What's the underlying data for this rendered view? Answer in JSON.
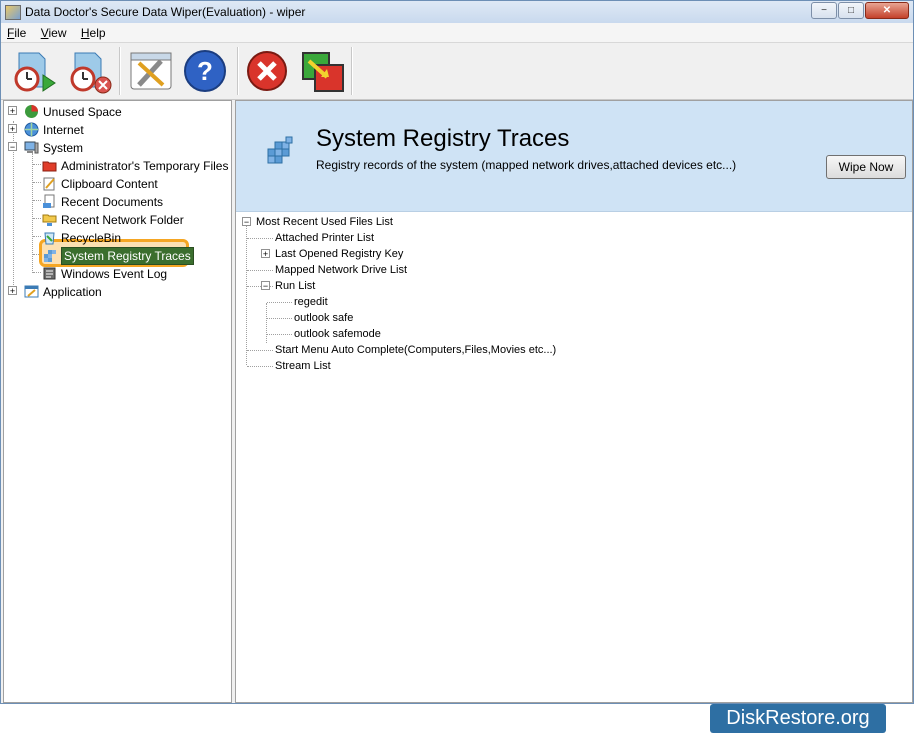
{
  "window": {
    "title": "Data Doctor's Secure Data Wiper(Evaluation) - wiper",
    "controls": {
      "minimize": "−",
      "maximize": "□",
      "close": "✕"
    }
  },
  "menu": {
    "file": "File",
    "view": "View",
    "help": "Help"
  },
  "toolbar": {
    "buttons": [
      {
        "icon": "schedule-wipe-icon"
      },
      {
        "icon": "stop-schedule-icon"
      },
      {
        "icon": "settings-tools-icon"
      },
      {
        "icon": "help-icon"
      },
      {
        "icon": "cancel-icon"
      },
      {
        "icon": "exit-icon"
      }
    ]
  },
  "left_tree": {
    "unused_space": "Unused Space",
    "internet": "Internet",
    "system": "System",
    "system_children": {
      "admin_temp": "Administrator's Temporary Files",
      "clipboard": "Clipboard Content",
      "recent_docs": "Recent Documents",
      "recent_network": "Recent Network Folder",
      "recycle_bin": "RecycleBin",
      "registry_traces": "System Registry Traces",
      "event_log": "Windows Event Log"
    },
    "application": "Application"
  },
  "header": {
    "title": "System Registry Traces",
    "description": "Registry records of the system (mapped network drives,attached devices etc...)",
    "wipe_button": "Wipe Now"
  },
  "right_tree": {
    "root": "Most Recent Used Files List",
    "attached_printer": "Attached Printer List",
    "last_opened_key": "Last Opened Registry Key",
    "mapped_drive": "Mapped Network Drive List",
    "run_list": "Run List",
    "run_children": {
      "regedit": "regedit",
      "outlook_safe": "outlook safe",
      "outlook_safemode": "outlook safemode"
    },
    "start_menu": "Start Menu Auto Complete(Computers,Files,Movies etc...)",
    "stream_list": "Stream List"
  },
  "watermark": "DiskRestore.org"
}
